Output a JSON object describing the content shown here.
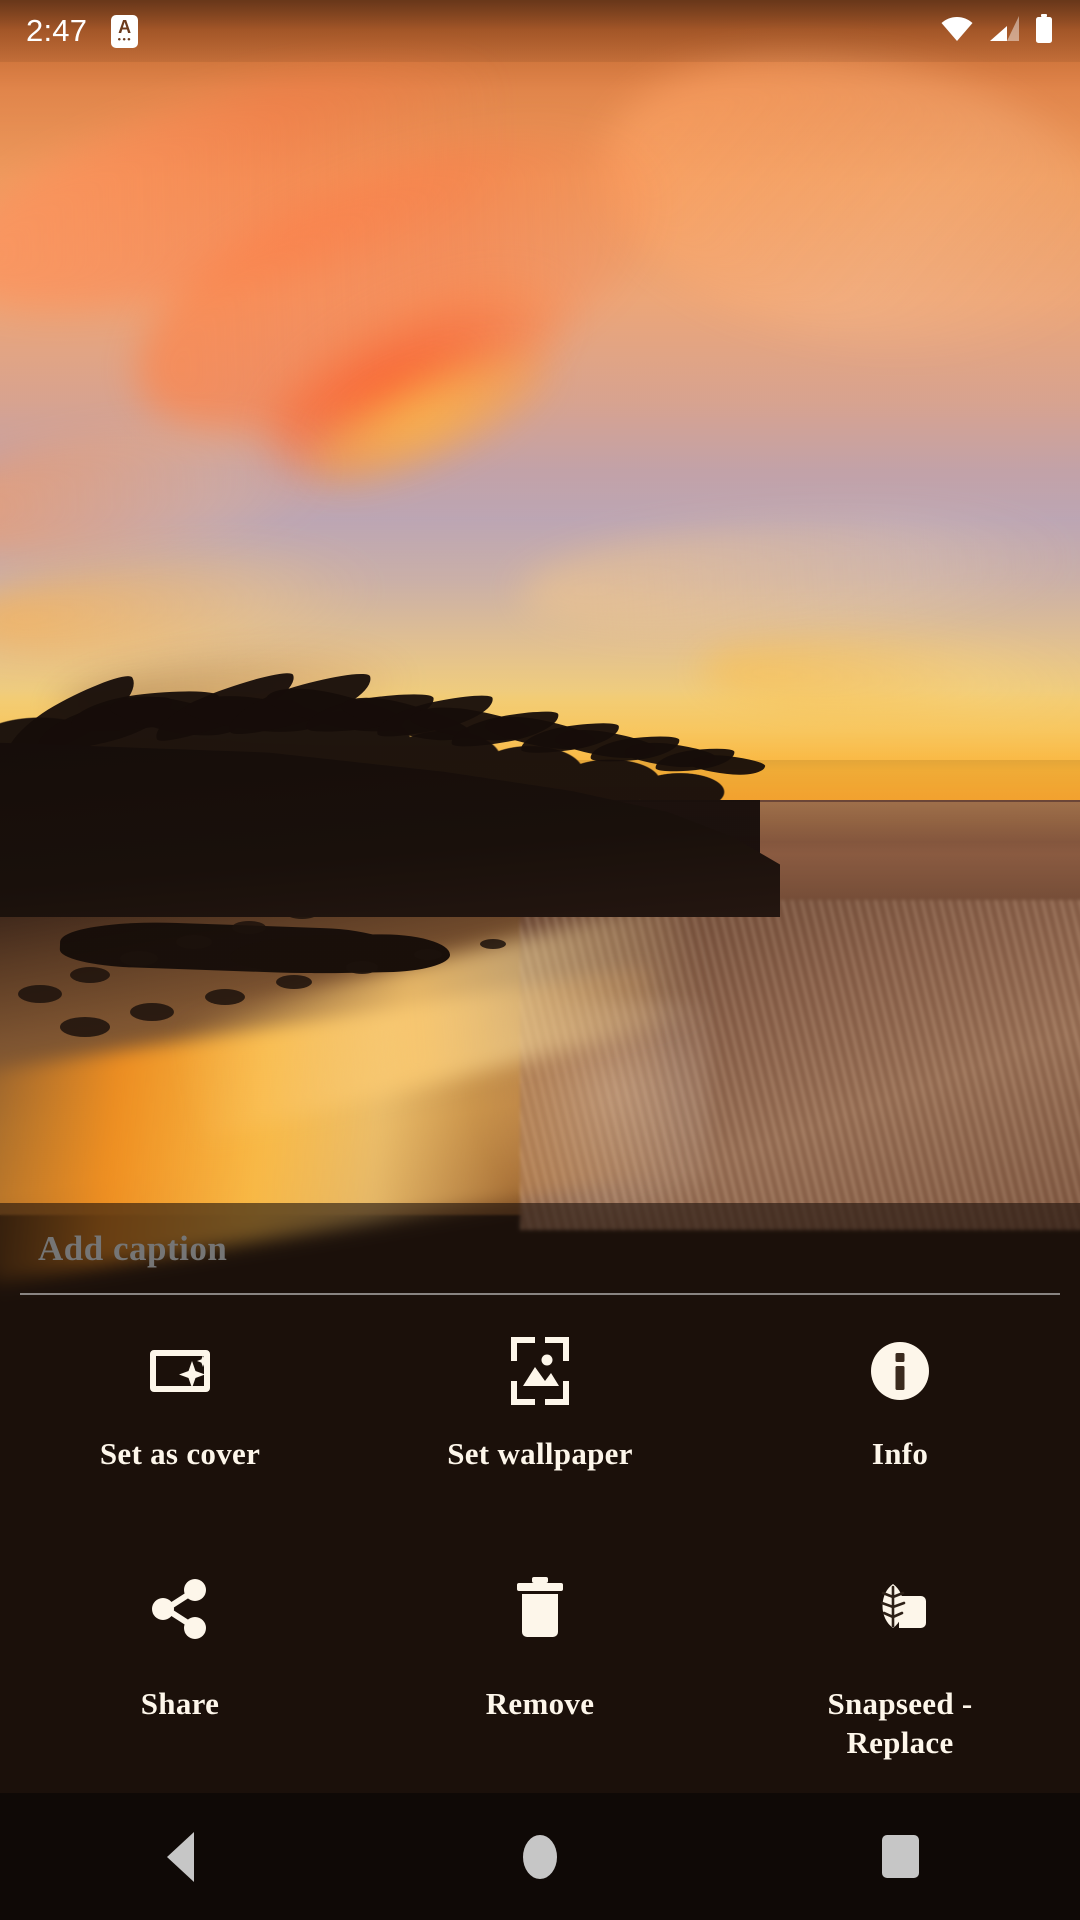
{
  "status_bar": {
    "clock": "2:47",
    "notification_icon": {
      "name": "app-notification-icon",
      "glyph": "A",
      "dots": "•••"
    },
    "icons": [
      {
        "name": "wifi-icon",
        "label": "Wi-Fi signal full"
      },
      {
        "name": "cellular-signal-icon",
        "label": "Cellular signal 2 bars"
      },
      {
        "name": "battery-icon",
        "label": "Battery full"
      }
    ]
  },
  "photo": {
    "description": "Tropical beach sunset with palm tree silhouettes and golden surf",
    "alt": "Sunset beach photo"
  },
  "caption": {
    "value": "",
    "placeholder": "Add caption"
  },
  "actions": [
    {
      "icon": "set-as-cover-icon",
      "label": "Set as cover"
    },
    {
      "icon": "set-wallpaper-icon",
      "label": "Set wallpaper"
    },
    {
      "icon": "info-icon",
      "label": "Info"
    },
    {
      "icon": "share-icon",
      "label": "Share"
    },
    {
      "icon": "trash-icon",
      "label": "Remove"
    },
    {
      "icon": "snapseed-leaf-icon",
      "label": "Snapseed - Replace"
    }
  ],
  "nav_bar": [
    {
      "icon": "back-triangle-icon",
      "label": "Back"
    },
    {
      "icon": "home-circle-icon",
      "label": "Home"
    },
    {
      "icon": "recents-square-icon",
      "label": "Recents"
    }
  ],
  "colors": {
    "icon_cream": "#fdf6ea",
    "caption_placeholder": "#a7a7a7",
    "sheet_overlay": "rgba(28,17,11,0.60)",
    "nav_icon": "#c6c6c6",
    "status_text": "#ffffff"
  }
}
